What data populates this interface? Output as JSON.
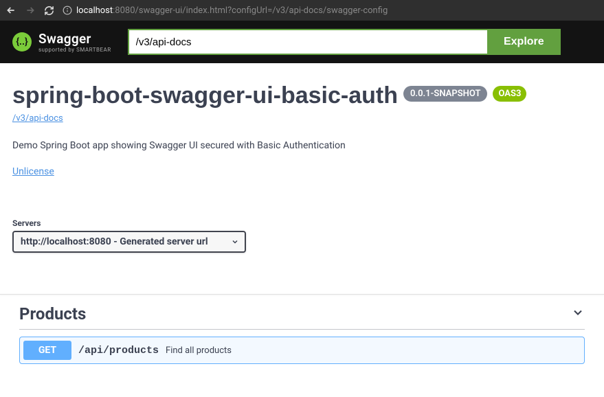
{
  "browser": {
    "url_host": "localhost",
    "url_rest": ":8080/swagger-ui/index.html?configUrl=/v3/api-docs/swagger-config"
  },
  "header": {
    "brand": "Swagger",
    "sub": "supported by SMARTBEAR",
    "explore_value": "/v3/api-docs",
    "explore_btn": "Explore"
  },
  "api": {
    "title": "spring-boot-swagger-ui-basic-auth",
    "version": "0.0.1-SNAPSHOT",
    "oas": "OAS3",
    "docs_url": "/v3/api-docs",
    "description": "Demo Spring Boot app showing Swagger UI secured with Basic Authentication",
    "license": "Unlicense"
  },
  "servers": {
    "label": "Servers",
    "selected": "http://localhost:8080 - Generated server url"
  },
  "tag": {
    "name": "Products"
  },
  "operation": {
    "method": "GET",
    "path": "/api/products",
    "summary": "Find all products"
  }
}
